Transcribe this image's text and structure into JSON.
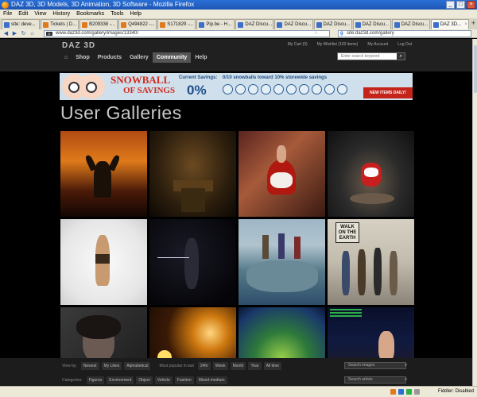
{
  "window": {
    "title": "DAZ 3D, 3D Models, 3D Animation, 3D Software - Mozilla Firefox"
  },
  "menu": [
    "File",
    "Edit",
    "View",
    "History",
    "Bookmarks",
    "Tools",
    "Help"
  ],
  "tabs": [
    {
      "label": "site: deve...",
      "icon": "page-icon"
    },
    {
      "label": "Tickets | D...",
      "icon": "ticket-icon"
    },
    {
      "label": "B209338 -...",
      "icon": "bug-icon"
    },
    {
      "label": "Q494822 -...",
      "icon": "bug-icon"
    },
    {
      "label": "S171829 -...",
      "icon": "bug-icon"
    },
    {
      "label": "Pip.be - H...",
      "icon": "page-icon"
    },
    {
      "label": "DAZ Discu...",
      "icon": "daz-icon"
    },
    {
      "label": "DAZ Discu...",
      "icon": "daz-icon"
    },
    {
      "label": "DAZ Discu...",
      "icon": "daz-icon"
    },
    {
      "label": "DAZ Discu...",
      "icon": "daz-icon"
    },
    {
      "label": "DAZ Discu...",
      "icon": "daz-icon"
    },
    {
      "label": "DAZ 3D...",
      "icon": "daz-icon",
      "active": true
    }
  ],
  "nav": {
    "url": "www.daz3d.com/gallery/images/13340/",
    "search": "site:daz3d.com/gallery"
  },
  "site": {
    "logo": "DAZ 3D",
    "toplinks": [
      "My Cart (0)",
      "My Wishlist (103 items)",
      "My Account",
      "Log Out"
    ],
    "nav": [
      "Home",
      "Shop",
      "Products",
      "Gallery",
      "Community",
      "Help"
    ],
    "active_nav": "Community",
    "search_placeholder": "Enter search keyword"
  },
  "banner": {
    "title": "SNOWBALL",
    "sub": "OF SAVINGS",
    "savings_label": "Current Savings:",
    "savings_pct": "0%",
    "progress_text": "0/10 snowballs toward 10% storewide savings",
    "cta": "NEW ITEMS DAILY!",
    "snowballs_total": 10,
    "snowballs_filled": 0
  },
  "page": {
    "title": "User Galleries"
  },
  "gallery": [
    "sunset-silhouette",
    "dark-room",
    "red-dress-dancer",
    "snow-dancer",
    "figure-pose",
    "night-swordswoman",
    "beach-group",
    "walking-on-earth",
    "dark-portrait",
    "fire-burst",
    "green-swirl",
    "text-post"
  ],
  "gallery_text": {
    "walk": "WALK ON THE EARTH"
  },
  "filters": {
    "row1_label": "View by:",
    "row1": [
      "Newest",
      "My Likes",
      "Alphabetical"
    ],
    "popular_label": "Most popular in last",
    "popular": [
      "24hr",
      "Week",
      "Month",
      "Year",
      "All time"
    ],
    "search_images": "Search images",
    "row2_label": "Categories:",
    "row2": [
      "Figures",
      "Environment",
      "Object",
      "Vehicle",
      "Fashion",
      "Mixed-medium"
    ],
    "search_artists": "Search artists"
  },
  "status": {
    "right": "Fiddler: Disabled"
  },
  "colors": {
    "accent": "#2a6fd6",
    "banner_red": "#c4241a",
    "banner_blue": "#1e4d86"
  }
}
